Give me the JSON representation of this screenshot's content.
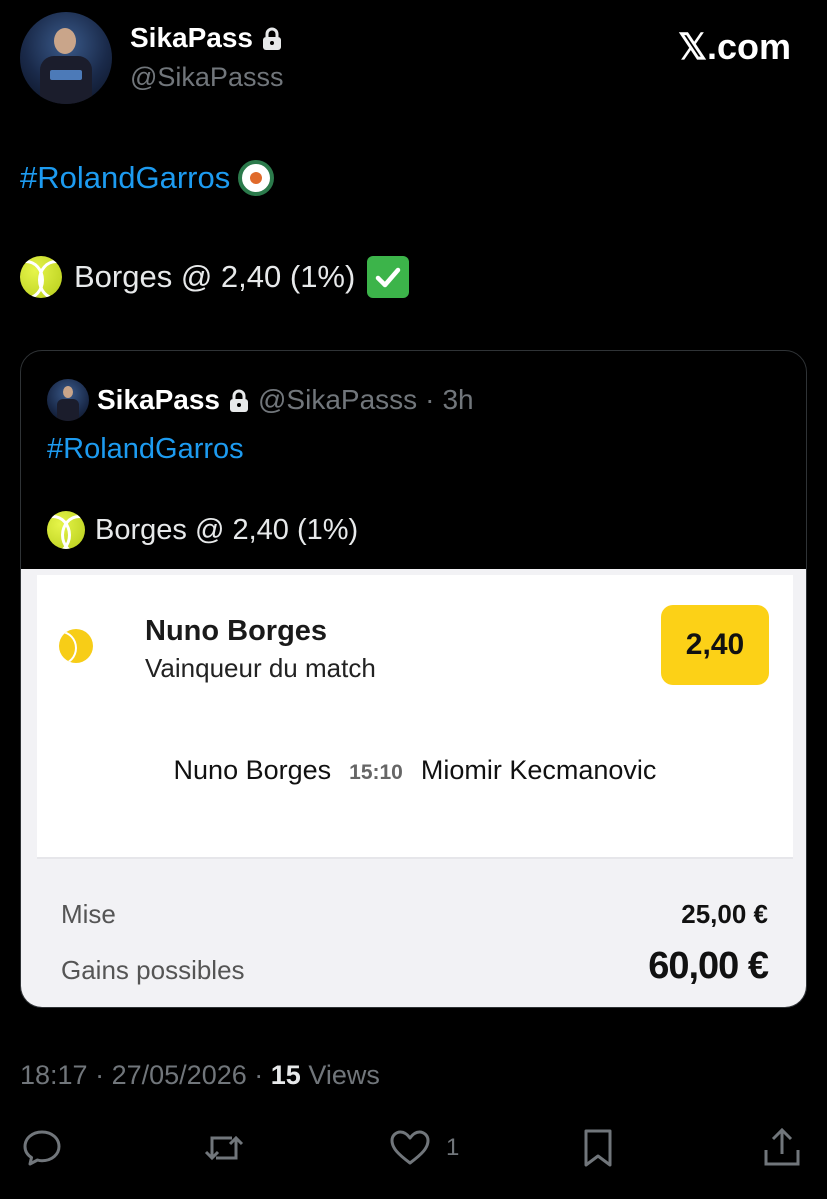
{
  "author": {
    "name": "SikaPass",
    "handle": "@SikaPasss"
  },
  "brand": "𝕏.com",
  "tweet": {
    "hashtag": "#RolandGarros",
    "bet_text": "Borges @ 2,40 (1%)"
  },
  "quoted": {
    "name": "SikaPass",
    "handle": "@SikaPasss",
    "separator": "·",
    "time": "3h",
    "hashtag": "#RolandGarros",
    "bet_text": "Borges @ 2,40 (1%)",
    "slip": {
      "player": "Nuno Borges",
      "market": "Vainqueur du match",
      "odds": "2,40",
      "home": "Nuno Borges",
      "match_time": "15:10",
      "away": "Miomir Kecmanovic",
      "stake_label": "Mise",
      "stake_value": "25,00 €",
      "payout_label": "Gains possibles",
      "payout_value": "60,00 €"
    }
  },
  "meta": {
    "time": "18:17",
    "sep1": "·",
    "date": "27/05/2026",
    "sep2": "·",
    "views_count": "15",
    "views_label": "Views"
  },
  "actions": {
    "like_count": "1"
  },
  "icons": {
    "lock": "lock-icon",
    "reply": "reply-icon",
    "retweet": "retweet-icon",
    "like": "heart-icon",
    "bookmark": "bookmark-icon",
    "share": "share-icon",
    "tennis_ball": "tennis-ball-icon",
    "check": "check-mark-icon",
    "rg_logo": "roland-garros-logo-icon"
  },
  "colors": {
    "background": "#000000",
    "link": "#1d9bf0",
    "muted": "#71767b",
    "odds_yellow": "#fcd117"
  }
}
